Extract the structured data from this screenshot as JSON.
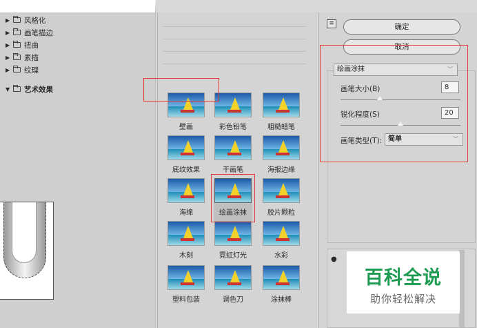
{
  "categories": [
    {
      "label": "风格化",
      "open": false
    },
    {
      "label": "画笔描边",
      "open": false
    },
    {
      "label": "扭曲",
      "open": false
    },
    {
      "label": "素描",
      "open": false
    },
    {
      "label": "纹理",
      "open": false
    },
    {
      "label": "艺术效果",
      "open": true
    }
  ],
  "filters": [
    {
      "label": "壁画"
    },
    {
      "label": "彩色铅笔"
    },
    {
      "label": "粗糙蜡笔"
    },
    {
      "label": "底纹效果"
    },
    {
      "label": "干画笔"
    },
    {
      "label": "海报边缘"
    },
    {
      "label": "海绵"
    },
    {
      "label": "绘画涂抹"
    },
    {
      "label": "胶片颗粒"
    },
    {
      "label": "木刻"
    },
    {
      "label": "霓虹灯光"
    },
    {
      "label": "水彩"
    },
    {
      "label": "塑料包装"
    },
    {
      "label": "调色刀"
    },
    {
      "label": "涂抹棒"
    }
  ],
  "selected_filter": "绘画涂抹",
  "buttons": {
    "ok": "确定",
    "cancel": "取消",
    "collapse": "≡"
  },
  "params": {
    "filter_select": "绘画涂抹",
    "brush_size": {
      "label": "画笔大小(B)",
      "value": "8",
      "fraction": 0.33
    },
    "sharpness": {
      "label": "锐化程度(S)",
      "value": "20",
      "fraction": 0.5
    },
    "brush_type": {
      "label": "画笔类型(T):",
      "value": "简单"
    }
  },
  "watermark": {
    "title": "百科全说",
    "subtitle": "助你轻松解决"
  },
  "colors": {
    "highlight": "#e53935",
    "watermark": "#1e9b52"
  }
}
